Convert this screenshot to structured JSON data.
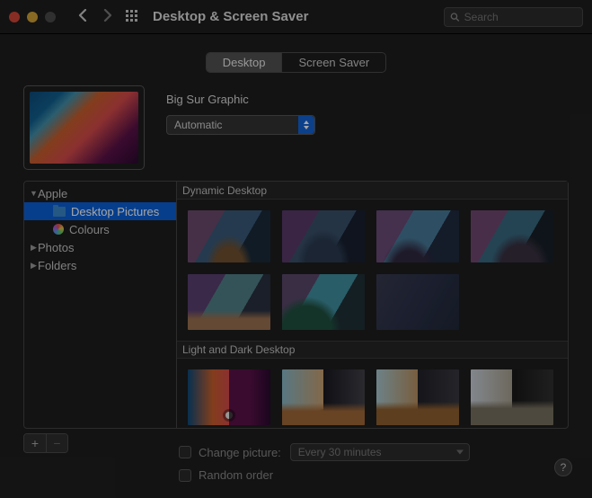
{
  "window": {
    "title": "Desktop & Screen Saver"
  },
  "search": {
    "placeholder": "Search"
  },
  "tabs": {
    "desktop": "Desktop",
    "screensaver": "Screen Saver",
    "active": 0
  },
  "wallpaper": {
    "name": "Big Sur Graphic",
    "mode": "Automatic"
  },
  "sidebar": {
    "items": [
      {
        "label": "Apple",
        "expanded": true,
        "depth": 0
      },
      {
        "label": "Desktop Pictures",
        "depth": 1,
        "icon": "folder",
        "selected": true
      },
      {
        "label": "Colours",
        "depth": 1,
        "icon": "colours"
      },
      {
        "label": "Photos",
        "depth": 0,
        "expanded": false
      },
      {
        "label": "Folders",
        "depth": 0,
        "expanded": false
      }
    ]
  },
  "sections": {
    "dynamic": "Dynamic Desktop",
    "lightdark": "Light and Dark Desktop"
  },
  "footer": {
    "change_picture": "Change picture:",
    "interval": "Every 30 minutes",
    "random": "Random order"
  }
}
